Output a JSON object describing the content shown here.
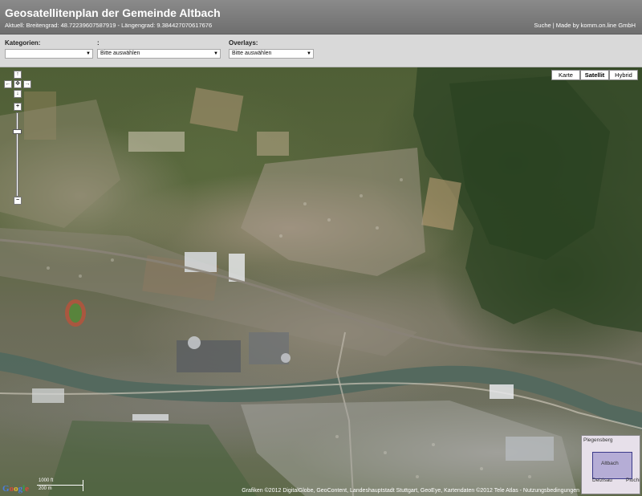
{
  "header": {
    "title": "Geosatellitenplan der Gemeinde Altbach",
    "subtitle": "Aktuell: Breitengrad: 48.72239607587919 - Längengrad: 9.384427070617676",
    "link_search": "Suche",
    "link_separator": " | ",
    "link_madeby": "Made by komm.on.line GmbH"
  },
  "filters": {
    "kategorien": {
      "label": "Kategorien:",
      "value": ""
    },
    "second": {
      "label": ":",
      "value": "Bitte auswählen"
    },
    "overlays": {
      "label": "Overlays:",
      "value": "Bitte auswählen"
    }
  },
  "map": {
    "maptypes": {
      "karte": "Karte",
      "satellit": "Satellit",
      "hybrid": "Hybrid",
      "active": "Satellit"
    },
    "controls": {
      "pan_up": "↑",
      "pan_left": "←",
      "pan_center": "✥",
      "pan_right": "→",
      "pan_down": "↓",
      "zoom_in": "+",
      "zoom_out": "−"
    },
    "overview": {
      "label_top": "Plegensberg",
      "label_center": "Altbach",
      "label_left": "Deizisau",
      "label_right": "Plochi"
    },
    "logo": {
      "g": "G",
      "o1": "o",
      "o2": "o",
      "g2": "g",
      "l": "l",
      "e": "e"
    },
    "scale": {
      "top": "1000 ft",
      "bottom": "200 m"
    },
    "copyright": "Grafiken ©2012 DigitalGlobe, GeoContent, Landeshauptstadt Stuttgart, GeoEye, Kartendaten ©2012 Tele Atlas - Nutzungsbedingungen"
  }
}
